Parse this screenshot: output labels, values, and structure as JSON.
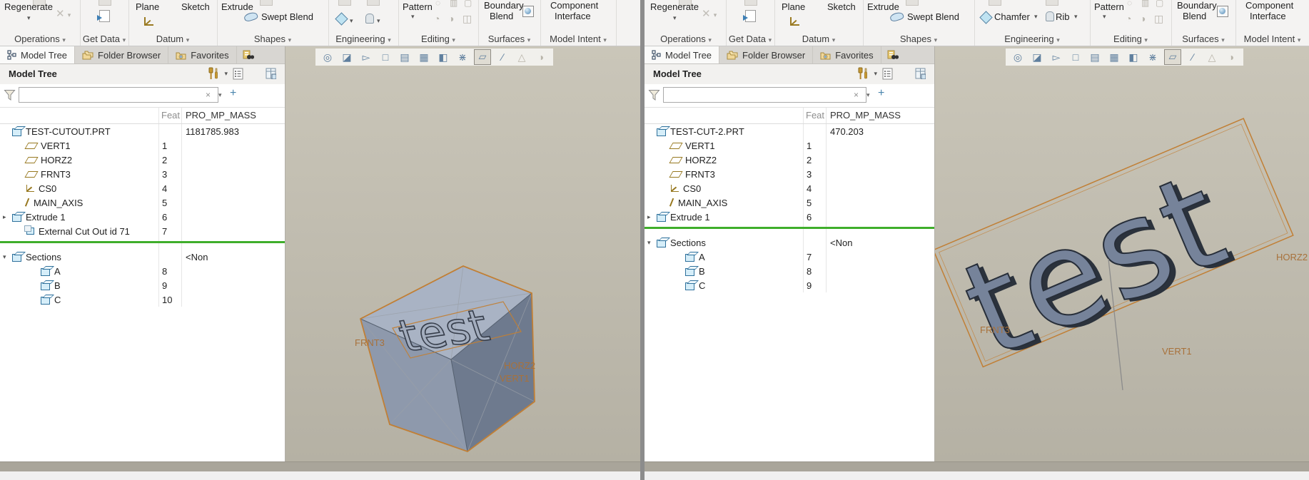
{
  "colors": {
    "insert_line_green": "#3fae2b",
    "sketch_orange": "#c17f35",
    "model_gray_blue": "#7a879c",
    "viewport_background": "#bdb9ac"
  },
  "left": {
    "ribbon": {
      "regenerate": "Regenerate",
      "plane": "Plane",
      "sketch": "Sketch",
      "extrude": "Extrude",
      "swept_blend": "Swept Blend",
      "pattern": "Pattern",
      "boundary_blend_1": "Boundary",
      "boundary_blend_2": "Blend",
      "component_interface_1": "Component",
      "component_interface_2": "Interface",
      "group_operations": "Operations",
      "group_get_data": "Get Data",
      "group_datum": "Datum",
      "group_shapes": "Shapes",
      "group_engineering": "Engineering",
      "group_editing": "Editing",
      "group_surfaces": "Surfaces",
      "group_model_intent": "Model Intent"
    },
    "panel": {
      "tab_model_tree": "Model Tree",
      "tab_folder_browser": "Folder Browser",
      "tab_favorites": "Favorites",
      "header": "Model Tree",
      "filter_value": "",
      "col_feat": "Feat",
      "col_mass": "PRO_MP_MASS",
      "rows": [
        {
          "label": "TEST-CUTOUT.PRT",
          "feat": "",
          "value": "1181785.983"
        },
        {
          "label": "VERT1",
          "feat": "1",
          "value": ""
        },
        {
          "label": "HORZ2",
          "feat": "2",
          "value": ""
        },
        {
          "label": "FRNT3",
          "feat": "3",
          "value": ""
        },
        {
          "label": "CS0",
          "feat": "4",
          "value": ""
        },
        {
          "label": "MAIN_AXIS",
          "feat": "5",
          "value": ""
        },
        {
          "label": "Extrude 1",
          "feat": "6",
          "value": ""
        },
        {
          "label": "External Cut Out id 71",
          "feat": "7",
          "value": ""
        },
        {
          "label": "Sections",
          "feat": "",
          "value": "<Non"
        },
        {
          "label": "A",
          "feat": "8",
          "value": ""
        },
        {
          "label": "B",
          "feat": "9",
          "value": ""
        },
        {
          "label": "C",
          "feat": "10",
          "value": ""
        }
      ]
    },
    "viewport": {
      "model_text": "test",
      "label_frnt": "FRNT3",
      "label_horz": "HORZ2",
      "label_vert": "VERT1"
    }
  },
  "right": {
    "ribbon": {
      "regenerate": "Regenerate",
      "plane": "Plane",
      "sketch": "Sketch",
      "extrude": "Extrude",
      "swept_blend": "Swept Blend",
      "chamfer": "Chamfer",
      "rib": "Rib",
      "pattern": "Pattern",
      "boundary_blend_1": "Boundary",
      "boundary_blend_2": "Blend",
      "component_interface_1": "Component",
      "component_interface_2": "Interface",
      "group_operations": "Operations",
      "group_get_data": "Get Data",
      "group_datum": "Datum",
      "group_shapes": "Shapes",
      "group_engineering": "Engineering",
      "group_editing": "Editing",
      "group_surfaces": "Surfaces",
      "group_model_intent": "Model Intent"
    },
    "panel": {
      "tab_model_tree": "Model Tree",
      "tab_folder_browser": "Folder Browser",
      "tab_favorites": "Favorites",
      "header": "Model Tree",
      "filter_value": "",
      "col_feat": "Feat",
      "col_mass": "PRO_MP_MASS",
      "rows": [
        {
          "label": "TEST-CUT-2.PRT",
          "feat": "",
          "value": "470.203"
        },
        {
          "label": "VERT1",
          "feat": "1",
          "value": ""
        },
        {
          "label": "HORZ2",
          "feat": "2",
          "value": ""
        },
        {
          "label": "FRNT3",
          "feat": "3",
          "value": ""
        },
        {
          "label": "CS0",
          "feat": "4",
          "value": ""
        },
        {
          "label": "MAIN_AXIS",
          "feat": "5",
          "value": ""
        },
        {
          "label": "Extrude 1",
          "feat": "6",
          "value": ""
        },
        {
          "label": "Sections",
          "feat": "",
          "value": "<Non"
        },
        {
          "label": "A",
          "feat": "7",
          "value": ""
        },
        {
          "label": "B",
          "feat": "8",
          "value": ""
        },
        {
          "label": "C",
          "feat": "9",
          "value": ""
        }
      ]
    },
    "viewport": {
      "model_text": "test",
      "label_frnt": "FRNT3",
      "label_horz": "HORZ2",
      "label_vert": "VERT1"
    }
  }
}
